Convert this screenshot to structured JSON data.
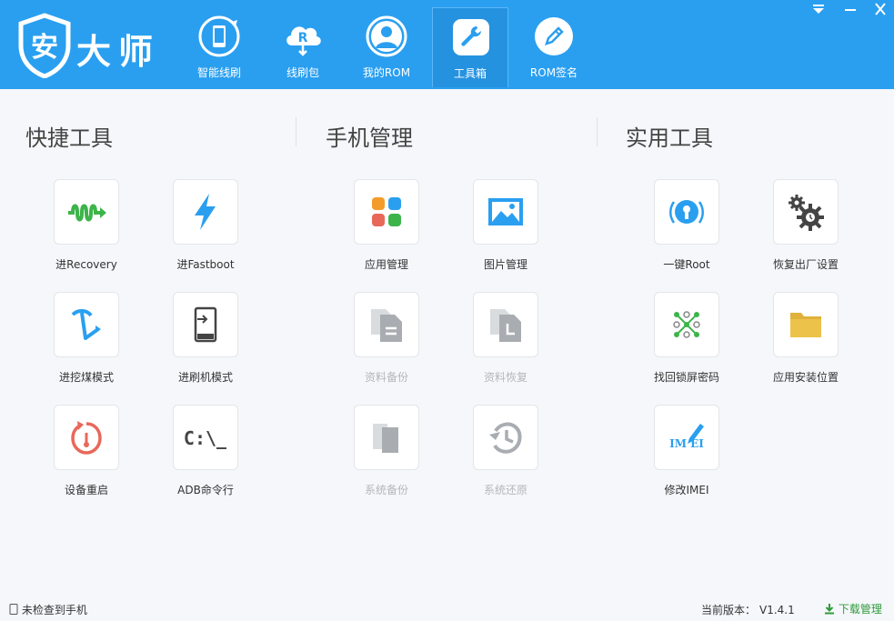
{
  "app": {
    "logo_text": "大师",
    "shield_char": "安"
  },
  "nav": {
    "tabs": [
      {
        "label": "智能线刷",
        "icon": "phone-refresh-icon"
      },
      {
        "label": "线刷包",
        "icon": "cloud-rom-icon",
        "icon_letter": "R"
      },
      {
        "label": "我的ROM",
        "icon": "user-avatar-icon"
      },
      {
        "label": "工具箱",
        "icon": "wrench-icon",
        "active": true
      },
      {
        "label": "ROM签名",
        "icon": "pen-icon"
      }
    ]
  },
  "sections": {
    "quick": {
      "title": "快捷工具"
    },
    "phone": {
      "title": "手机管理"
    },
    "util": {
      "title": "实用工具"
    }
  },
  "tools": {
    "recovery": {
      "label": "进Recovery",
      "icon": "recovery-wave-icon"
    },
    "fastboot": {
      "label": "进Fastboot",
      "icon": "lightning-icon"
    },
    "dig": {
      "label": "进挖煤模式",
      "icon": "pickaxe-icon"
    },
    "flash": {
      "label": "进刷机模式",
      "icon": "phone-enter-icon"
    },
    "reboot": {
      "label": "设备重启",
      "icon": "reboot-icon"
    },
    "adb": {
      "label": "ADB命令行",
      "icon": "terminal-icon",
      "icon_text": "C:\\_"
    },
    "apps": {
      "label": "应用管理",
      "icon": "app-grid-icon"
    },
    "photos": {
      "label": "图片管理",
      "icon": "image-icon"
    },
    "backup": {
      "label": "资料备份",
      "icon": "document-backup-icon",
      "disabled": true
    },
    "restore": {
      "label": "资料恢复",
      "icon": "document-restore-icon",
      "disabled": true
    },
    "sysbackup": {
      "label": "系统备份",
      "icon": "system-backup-icon",
      "disabled": true
    },
    "sysrestore": {
      "label": "系统还原",
      "icon": "history-icon",
      "disabled": true
    },
    "root": {
      "label": "一键Root",
      "icon": "keyhole-icon"
    },
    "factory": {
      "label": "恢复出厂设置",
      "icon": "gears-icon"
    },
    "pattern": {
      "label": "找回锁屏密码",
      "icon": "pattern-lock-icon"
    },
    "installloc": {
      "label": "应用安装位置",
      "icon": "folder-icon"
    },
    "imei": {
      "label": "修改IMEI",
      "icon": "imei-edit-icon",
      "icon_text": "IM  EI"
    }
  },
  "status": {
    "device": "未检查到手机",
    "version_label": "当前版本：",
    "version": "V1.4.1",
    "download": "下载管理"
  },
  "colors": {
    "header_bg": "#2a9ff0",
    "accent_green": "#2e9b3a",
    "disabled_text": "#b3b7bc"
  }
}
